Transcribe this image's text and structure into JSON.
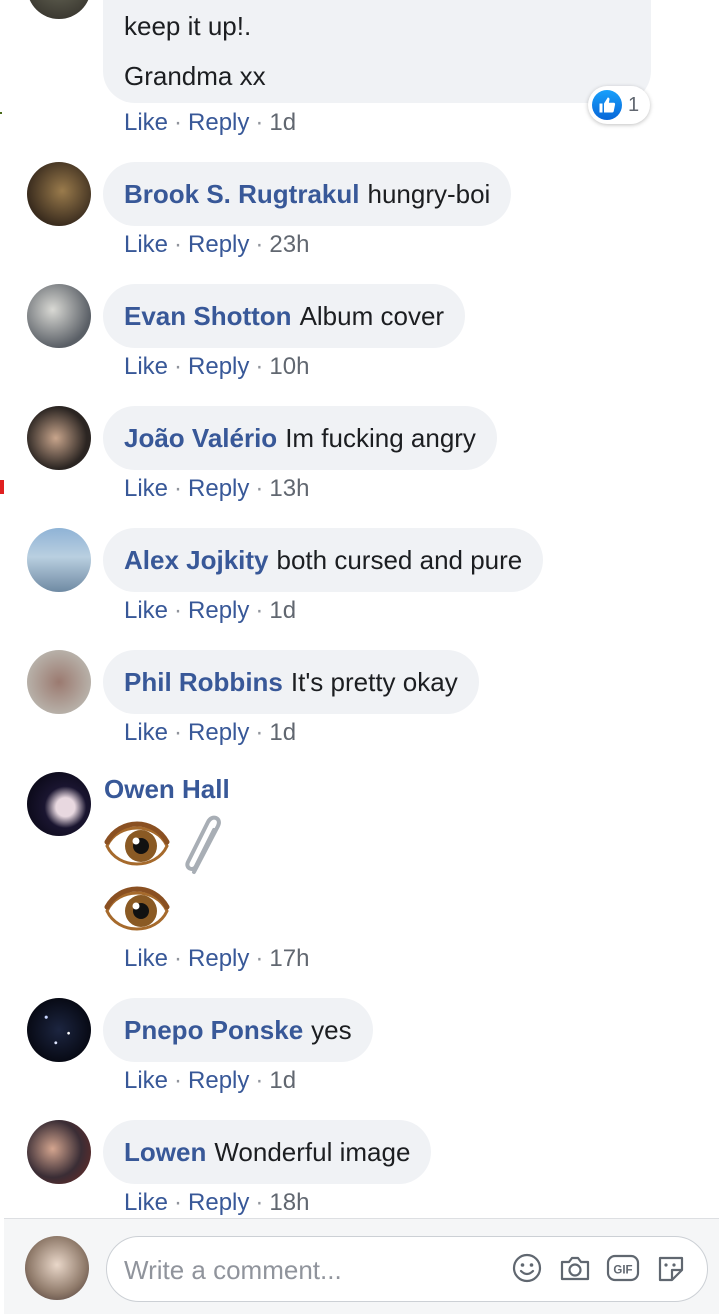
{
  "colors": {
    "link": "#385898",
    "bubble": "#f0f2f5",
    "meta": "#616770",
    "like_blue": "#1877f2"
  },
  "top_comment": {
    "line1": "keep it up!.",
    "line2": "Grandma xx",
    "reaction_count": "1",
    "actions": {
      "like": "Like",
      "reply": "Reply",
      "time": "1d"
    }
  },
  "comments": [
    {
      "author": "Brook S. Rugtrakul",
      "text": "hungry-boi",
      "like": "Like",
      "reply": "Reply",
      "time": "23h"
    },
    {
      "author": "Evan Shotton",
      "text": "Album cover",
      "like": "Like",
      "reply": "Reply",
      "time": "10h"
    },
    {
      "author": "João Valério",
      "text": "Im fucking angry",
      "like": "Like",
      "reply": "Reply",
      "time": "13h"
    },
    {
      "author": "Alex Jojkity",
      "text": "both cursed and pure",
      "like": "Like",
      "reply": "Reply",
      "time": "1d"
    },
    {
      "author": "Phil Robbins",
      "text": "It's pretty okay",
      "like": "Like",
      "reply": "Reply",
      "time": "1d"
    }
  ],
  "owen": {
    "author": "Owen Hall",
    "like": "Like",
    "reply": "Reply",
    "time": "17h",
    "emojis": [
      "eye-emoji",
      "paperclip-emoji",
      "eye-emoji"
    ]
  },
  "comments_after": [
    {
      "author": "Pnepo Ponske",
      "text": "yes",
      "like": "Like",
      "reply": "Reply",
      "time": "1d"
    },
    {
      "author": "Lowen",
      "text": "Wonderful image",
      "like": "Like",
      "reply": "Reply",
      "time": "18h"
    }
  ],
  "composer": {
    "placeholder": "Write a comment...",
    "icons": [
      "smiley-icon",
      "camera-icon",
      "gif-icon",
      "sticker-icon"
    ],
    "gif_label": "GIF"
  }
}
